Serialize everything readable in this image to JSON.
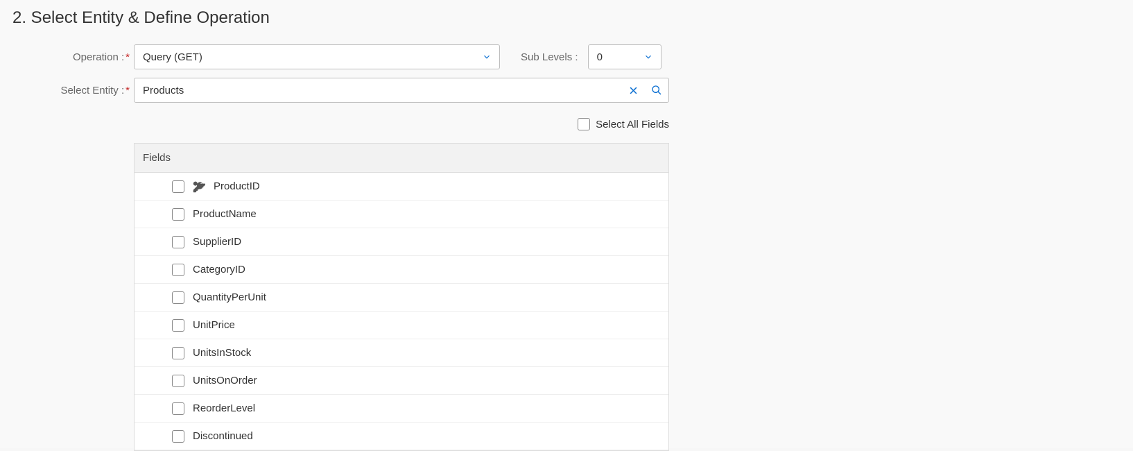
{
  "section": {
    "title": "2. Select Entity & Define Operation"
  },
  "form": {
    "operation_label": "Operation :",
    "operation_value": "Query (GET)",
    "sublevels_label": "Sub Levels :",
    "sublevels_value": "0",
    "entity_label": "Select Entity :",
    "entity_value": "Products",
    "select_all_label": "Select All Fields"
  },
  "fields": {
    "header": "Fields",
    "items": [
      {
        "name": "ProductID",
        "is_key": true
      },
      {
        "name": "ProductName",
        "is_key": false
      },
      {
        "name": "SupplierID",
        "is_key": false
      },
      {
        "name": "CategoryID",
        "is_key": false
      },
      {
        "name": "QuantityPerUnit",
        "is_key": false
      },
      {
        "name": "UnitPrice",
        "is_key": false
      },
      {
        "name": "UnitsInStock",
        "is_key": false
      },
      {
        "name": "UnitsOnOrder",
        "is_key": false
      },
      {
        "name": "ReorderLevel",
        "is_key": false
      },
      {
        "name": "Discontinued",
        "is_key": false
      }
    ]
  }
}
